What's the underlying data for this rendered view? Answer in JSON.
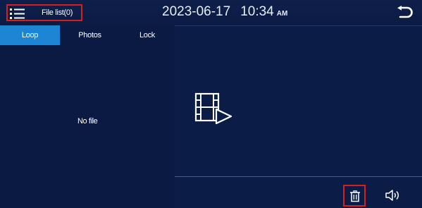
{
  "header": {
    "menu_icon": "list-menu-icon",
    "file_list_label": "File list(0)",
    "date": "2023-06-17",
    "time": "10:34",
    "ampm": "AM",
    "back_icon": "back-arrow-icon"
  },
  "tabs": [
    {
      "label": "Loop",
      "active": true
    },
    {
      "label": "Photos",
      "active": false
    },
    {
      "label": "Lock",
      "active": false
    }
  ],
  "file_list": {
    "empty_text": "No file"
  },
  "preview": {
    "icon": "video-file-icon"
  },
  "toolbar": {
    "delete_icon": "trash-icon",
    "volume_icon": "speaker-icon"
  },
  "colors": {
    "background": "#0a1a42",
    "active_tab": "#1c86d4",
    "highlight_box": "#d32020",
    "text": "#ffffff"
  }
}
